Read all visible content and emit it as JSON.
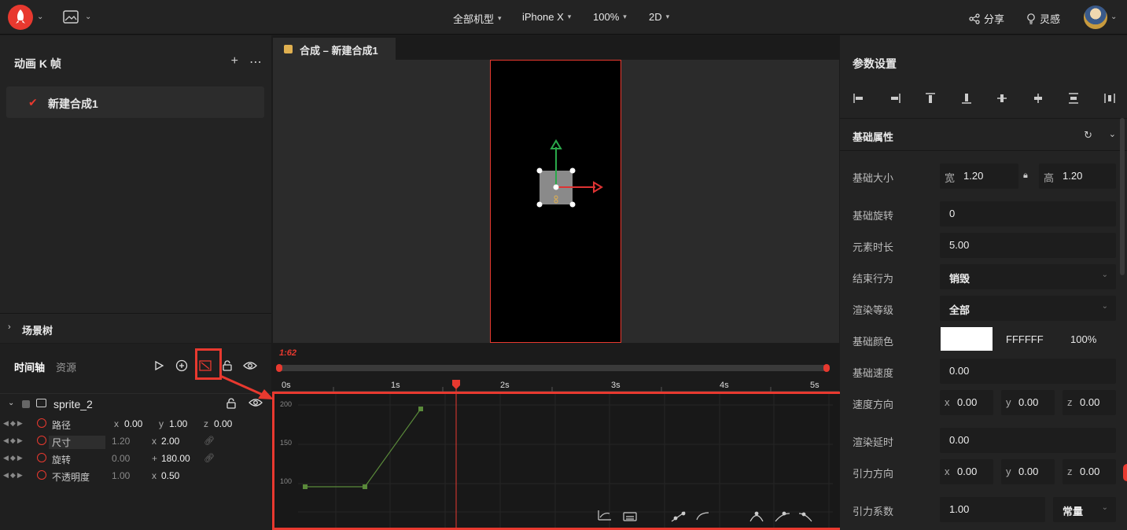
{
  "topbar": {
    "device_type": "全部机型",
    "device": "iPhone X",
    "zoom": "100%",
    "mode": "2D",
    "share": "分享",
    "inspiration": "灵感"
  },
  "left_panel": {
    "title": "动画 K 帧",
    "composition": "新建合成1",
    "scene_tree": "场景树"
  },
  "timeline": {
    "tabs": [
      "时间轴",
      "资源"
    ],
    "current_time": "1:62",
    "ticks": [
      "0s",
      "1s",
      "2s",
      "3s",
      "4s",
      "5s"
    ],
    "sprite_name": "sprite_2",
    "props": [
      {
        "name": "路径",
        "a_label": "x",
        "a": "0.00",
        "b_label": "y",
        "b": "1.00",
        "c_label": "z",
        "c": "0.00"
      },
      {
        "name": "尺寸",
        "a": "1.20",
        "b_label": "x",
        "b": "2.00"
      },
      {
        "name": "旋转",
        "a": "0.00",
        "b_label": "+",
        "b": "180.00"
      },
      {
        "name": "不透明度",
        "a": "1.00",
        "b_label": "x",
        "b": "0.50"
      }
    ],
    "graph": {
      "y_labels": [
        "200",
        "150",
        "100"
      ]
    }
  },
  "canvas": {
    "tab_label": "合成 – 新建合成1"
  },
  "params": {
    "title": "参数设置",
    "section": "基础属性",
    "size_label": "基础大小",
    "width_label": "宽",
    "width": "1.20",
    "height_label": "高",
    "height": "1.20",
    "rotation_label": "基础旋转",
    "rotation": "0",
    "duration_label": "元素时长",
    "duration": "5.00",
    "end_label": "结束行为",
    "end": "销毁",
    "render_level_label": "渲染等级",
    "render_level": "全部",
    "color_label": "基础颜色",
    "color_hex": "FFFFFF",
    "color_alpha": "100%",
    "speed_label": "基础速度",
    "speed": "0.00",
    "speed_dir_label": "速度方向",
    "speed_dir": {
      "x": "0.00",
      "y": "0.00",
      "z": "0.00"
    },
    "render_delay_label": "渲染延时",
    "render_delay": "0.00",
    "gravity_dir_label": "引力方向",
    "gravity_dir": {
      "x": "0.00",
      "y": "0.00",
      "z": "0.00"
    },
    "gravity_coef_label": "引力系数",
    "gravity_coef": "1.00",
    "gravity_mode": "常量"
  }
}
